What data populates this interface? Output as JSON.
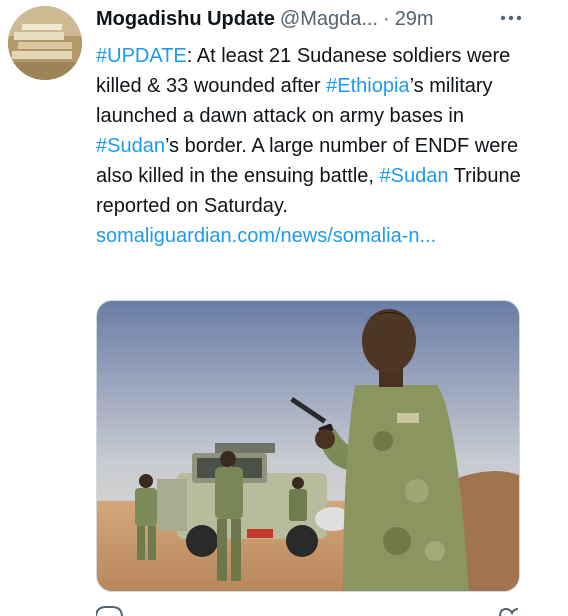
{
  "tweet": {
    "author": {
      "display_name": "Mogadishu Update",
      "handle": "@Magda...",
      "avatar_icon": "avatar-image"
    },
    "separator": "·",
    "timestamp": "29m",
    "more_icon": "more-options-icon",
    "text": {
      "seg1": "#UPDATE",
      "seg2": ": At least 21 Sudanese soldiers were killed & 33 wounded after ",
      "seg3": "#Ethiopia",
      "seg4": "’s military launched a dawn attack on army bases in ",
      "seg5": "#Sudan",
      "seg6": "’s border. A large number of ENDF were also killed in the ensuing battle, ",
      "seg7": "#Sudan",
      "seg8": " Tribune reported on Saturday."
    },
    "link_text": "somaliguardian.com/news/somalia-n...",
    "media": {
      "description_icon": "soldiers-photo"
    }
  },
  "colors": {
    "accent": "#1d9bf0",
    "text": "#0f1419",
    "muted": "#536471"
  }
}
